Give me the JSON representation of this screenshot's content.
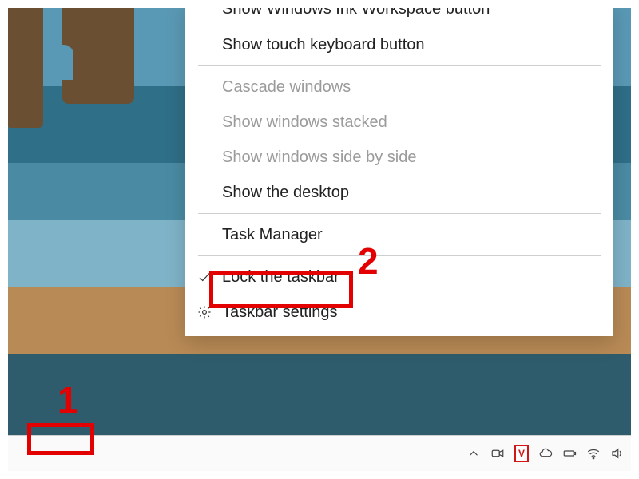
{
  "menu": {
    "groups": [
      [
        {
          "id": "ink",
          "label": "Show Windows Ink Workspace button",
          "enabled": true,
          "cut": true
        },
        {
          "id": "touch",
          "label": "Show touch keyboard button",
          "enabled": true
        }
      ],
      [
        {
          "id": "cascade",
          "label": "Cascade windows",
          "enabled": false
        },
        {
          "id": "stack",
          "label": "Show windows stacked",
          "enabled": false
        },
        {
          "id": "side",
          "label": "Show windows side by side",
          "enabled": false
        },
        {
          "id": "desk",
          "label": "Show the desktop",
          "enabled": true
        }
      ],
      [
        {
          "id": "taskmgr",
          "label": "Task Manager",
          "enabled": true
        }
      ],
      [
        {
          "id": "lock",
          "label": "Lock the taskbar",
          "enabled": true,
          "icon": "check"
        },
        {
          "id": "settings",
          "label": "Taskbar settings",
          "enabled": true,
          "icon": "gear"
        }
      ]
    ]
  },
  "tray": {
    "items": [
      {
        "id": "overflow",
        "name": "tray-overflow-icon"
      },
      {
        "id": "meet",
        "name": "video-chat-icon"
      },
      {
        "id": "v",
        "name": "v-app-icon",
        "letter": "V"
      },
      {
        "id": "cloud",
        "name": "onedrive-icon"
      },
      {
        "id": "battery",
        "name": "battery-icon"
      },
      {
        "id": "wifi",
        "name": "wifi-icon"
      },
      {
        "id": "volume",
        "name": "volume-icon"
      }
    ]
  },
  "annotations": {
    "one": "1",
    "two": "2"
  }
}
